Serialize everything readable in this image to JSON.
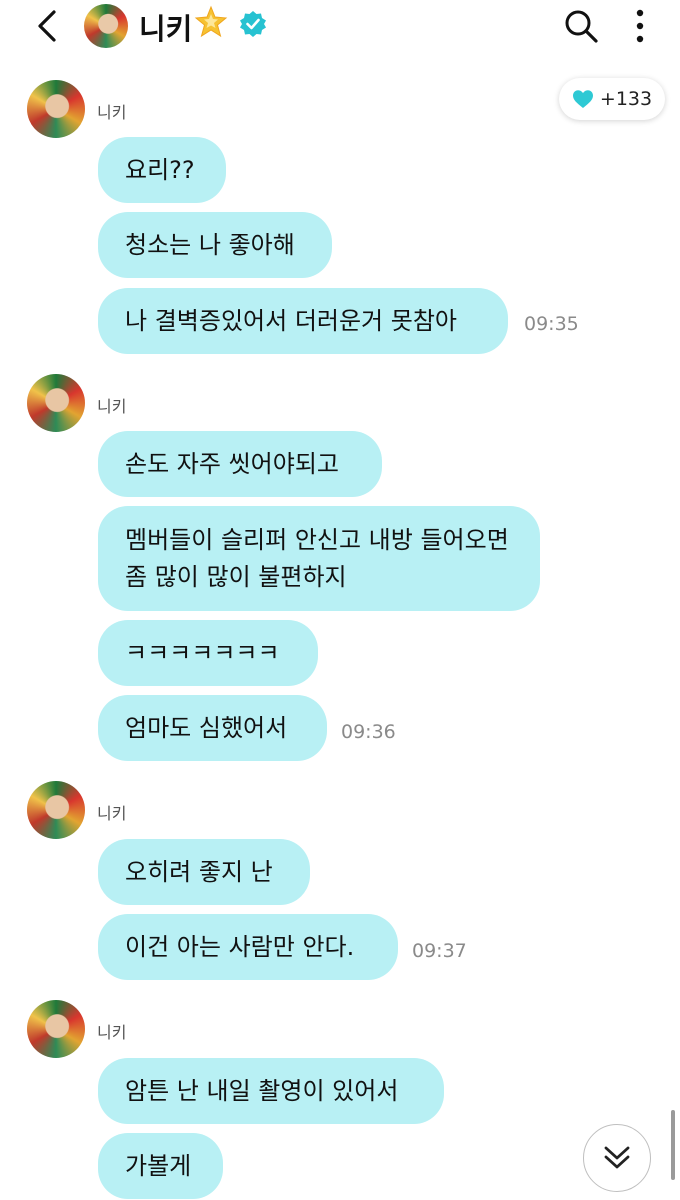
{
  "header": {
    "title": "니키",
    "icons": [
      "back-icon",
      "star-icon",
      "verified-icon",
      "search-icon",
      "more-icon"
    ],
    "verified_color": "#27c2d1"
  },
  "reaction": {
    "count": "+133",
    "icon": "heart-icon",
    "color": "#2ec9d4"
  },
  "groups": [
    {
      "sender": "니키",
      "messages": [
        "요리??",
        "청소는 나 좋아해",
        "나 결벽증있어서 더러운거 못참아"
      ],
      "time": "09:35"
    },
    {
      "sender": "니키",
      "messages": [
        "손도 자주 씻어야되고",
        "멤버들이 슬리퍼 안신고 내방 들어오면 좀 많이 많이 불편하지",
        "ㅋㅋㅋㅋㅋㅋㅋ",
        "엄마도 심했어서"
      ],
      "time": "09:36"
    },
    {
      "sender": "니키",
      "messages": [
        "오히려 좋지 난",
        "이건 아는 사람만 안다."
      ],
      "time": "09:37"
    },
    {
      "sender": "니키",
      "messages": [
        "암튼 난 내일 촬영이 있어서",
        "가볼게"
      ],
      "time": ""
    }
  ],
  "colors": {
    "bubble": "#b8f0f4",
    "time": "#8a8a8a"
  },
  "scroll_button": {
    "icon": "double-chevron-down-icon"
  }
}
